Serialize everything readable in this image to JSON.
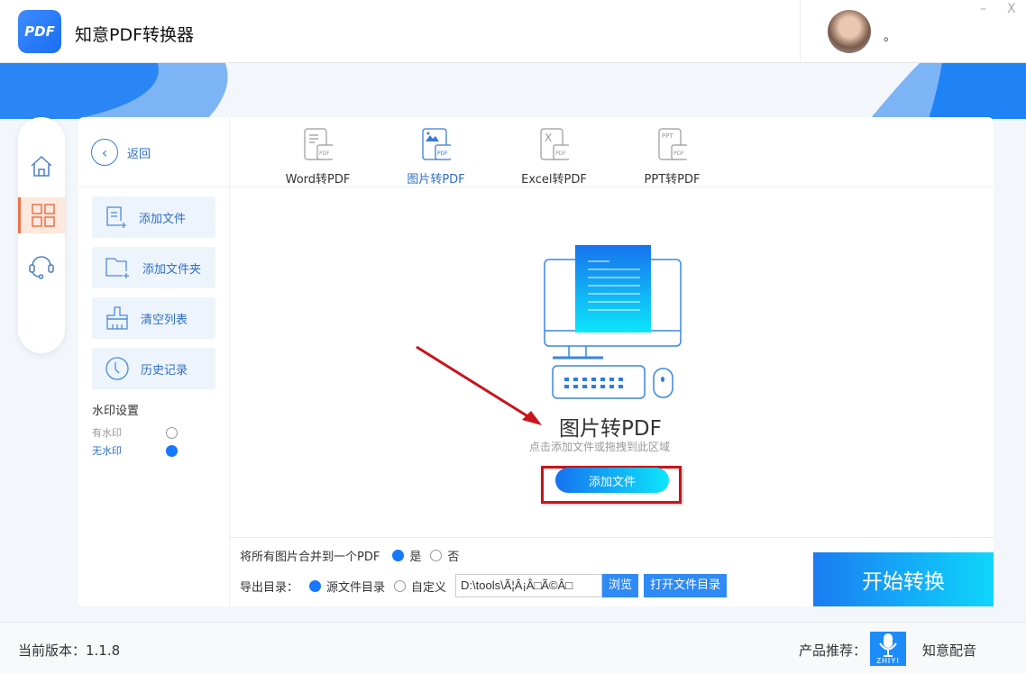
{
  "app": {
    "title": "知意PDF转换器",
    "logo_text": "PDF",
    "username": "。",
    "minimize": "–",
    "close": "X"
  },
  "nav": {
    "items": [
      {
        "name": "home"
      },
      {
        "name": "tools"
      },
      {
        "name": "support"
      }
    ]
  },
  "left": {
    "back": "返回",
    "actions": [
      "添加文件",
      "添加文件夹",
      "清空列表",
      "历史记录"
    ],
    "watermark_title": "水印设置",
    "watermark_options": [
      "有水印",
      "无水印"
    ],
    "watermark_selected": "无水印"
  },
  "tabs": [
    {
      "label": "Word转PDF",
      "icon_text": ""
    },
    {
      "label": "图片转PDF",
      "icon_text": ""
    },
    {
      "label": "Excel转PDF",
      "icon_text": "X"
    },
    {
      "label": "PPT转PDF",
      "icon_text": "PPT"
    }
  ],
  "tab_icon_badge": "PDF",
  "drop": {
    "title": "图片转PDF",
    "hint": "点击添加文件或拖拽到此区域",
    "add_button": "添加文件"
  },
  "bottom": {
    "merge_label": "将所有图片合并到一个PDF",
    "merge_yes": "是",
    "merge_no": "否",
    "export_label": "导出目录：",
    "export_source": "源文件目录",
    "export_custom": "自定义",
    "path_value": "D:\\tools\\Ã¦Â¡Â□Ã©Â□",
    "browse": "浏览",
    "open_dir": "打开文件目录"
  },
  "start_button": "开始转换",
  "footer": {
    "version": "当前版本：1.1.8",
    "recommend": "产品推荐：",
    "product": "知意配音",
    "product_icon_text": "ZHIYI"
  },
  "colors": {
    "accent": "#1677ff",
    "active_nav": "#e8734a",
    "annotation": "#c8141a"
  }
}
